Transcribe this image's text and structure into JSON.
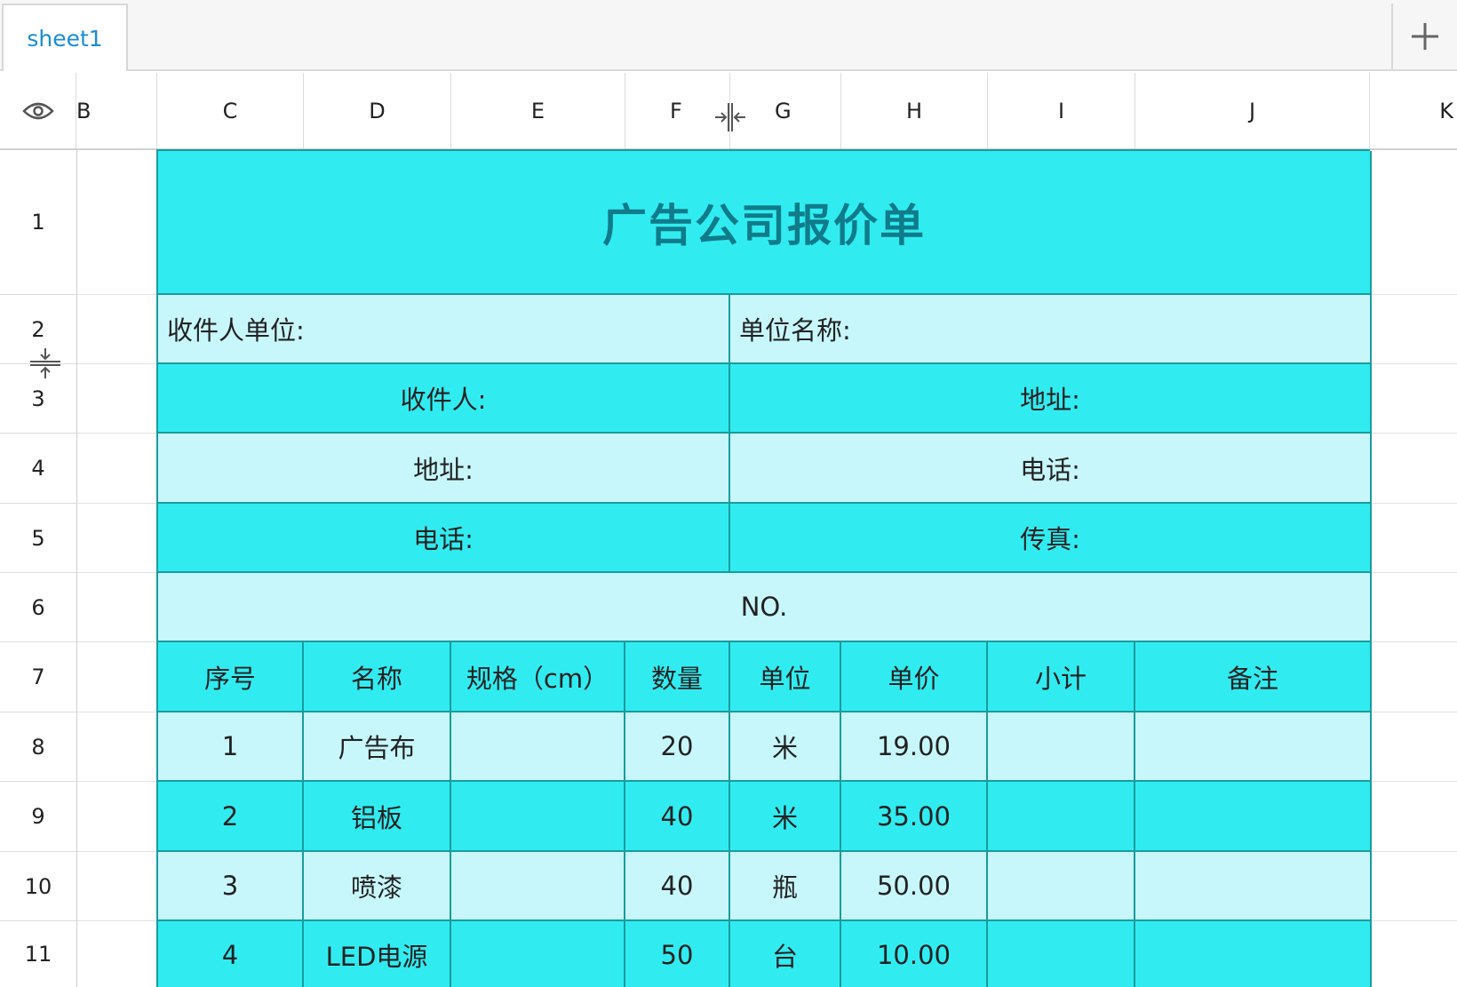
{
  "tabs": [
    {
      "label": "sheet1"
    }
  ],
  "columns": [
    "B",
    "C",
    "D",
    "E",
    "F",
    "G",
    "H",
    "I",
    "J",
    "K"
  ],
  "rows": [
    "1",
    "2",
    "3",
    "4",
    "5",
    "6",
    "7",
    "8",
    "9",
    "10",
    "11"
  ],
  "sheet": {
    "title": "广告公司报价单",
    "recipient_unit": "收件人单位:",
    "unit_name": "单位名称:",
    "recipient": "收件人:",
    "address_1": "地址:",
    "address_2": "地址:",
    "phone_1": "电话:",
    "phone_2": "电话:",
    "fax": "传真:",
    "no": "NO.",
    "table_headers": [
      "序号",
      "名称",
      "规格（cm）",
      "数量",
      "单位",
      "单价",
      "小计",
      "备注"
    ],
    "items": [
      {
        "index": "1",
        "name": "广告布",
        "spec": "",
        "qty": "20",
        "unit": "米",
        "price": "19.00",
        "subtotal": "",
        "note": ""
      },
      {
        "index": "2",
        "name": "铝板",
        "spec": "",
        "qty": "40",
        "unit": "米",
        "price": "35.00",
        "subtotal": "",
        "note": ""
      },
      {
        "index": "3",
        "name": "喷漆",
        "spec": "",
        "qty": "40",
        "unit": "瓶",
        "price": "50.00",
        "subtotal": "",
        "note": ""
      },
      {
        "index": "4",
        "name": "LED电源",
        "spec": "",
        "qty": "50",
        "unit": "台",
        "price": "10.00",
        "subtotal": "",
        "note": ""
      }
    ]
  },
  "colors": {
    "cyan": "#30ecf0",
    "pale_cyan": "#c8f7fb",
    "border": "#1a9b9e",
    "title": "#107b8a",
    "tab_text": "#1a8cd8"
  },
  "icons": {
    "corner": "eye-icon",
    "add_sheet": "plus-icon",
    "col_resize": "column-resize-icon",
    "row_resize": "row-resize-icon"
  }
}
